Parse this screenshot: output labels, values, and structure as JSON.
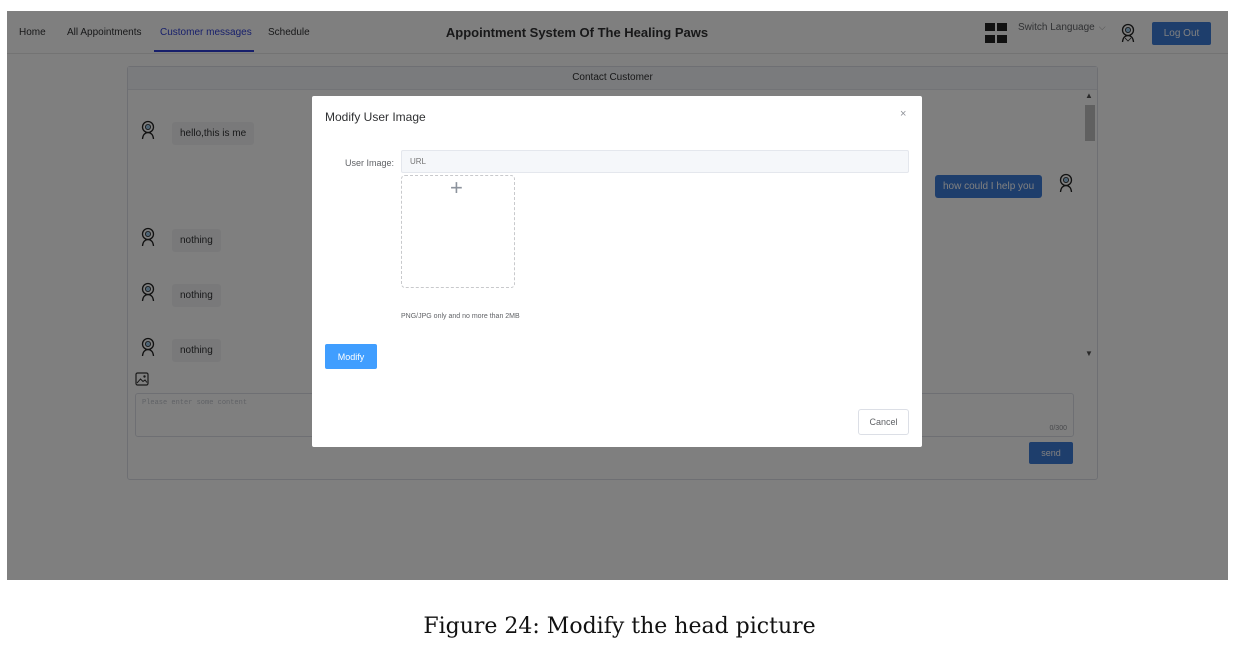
{
  "nav": {
    "items": [
      {
        "label": "Home"
      },
      {
        "label": "All Appointments"
      },
      {
        "label": "Customer messages"
      },
      {
        "label": "Schedule"
      }
    ],
    "active_index": 2
  },
  "header": {
    "title": "Appointment System Of The Healing Paws",
    "switch_language": "Switch Language",
    "logout_label": "Log Out"
  },
  "chat": {
    "title": "Contact Customer",
    "messages": [
      {
        "side": "customer",
        "text": "hello,this is me"
      },
      {
        "side": "self",
        "text": "how could I help you"
      },
      {
        "side": "customer",
        "text": "nothing"
      },
      {
        "side": "customer",
        "text": "nothing"
      },
      {
        "side": "customer",
        "text": "nothing"
      }
    ],
    "input_placeholder": "Please enter some content",
    "char_count": "0/300",
    "send_label": "send"
  },
  "dialog": {
    "title": "Modify User Image",
    "field_label": "User Image:",
    "url_placeholder": "URL",
    "upload_tip": "PNG/JPG only and no more than 2MB",
    "modify_label": "Modify",
    "cancel_label": "Cancel",
    "close_symbol": "×"
  },
  "caption": "Figure 24: Modify the head picture",
  "colors": {
    "primary": "#409eff",
    "active_nav": "#2f3fd6",
    "self_bubble": "#3d7dd9"
  },
  "icons": {
    "avatar": "avatar-icon",
    "grid": "grid-icon",
    "image": "image-icon",
    "close": "close-icon",
    "plus": "plus-icon"
  }
}
